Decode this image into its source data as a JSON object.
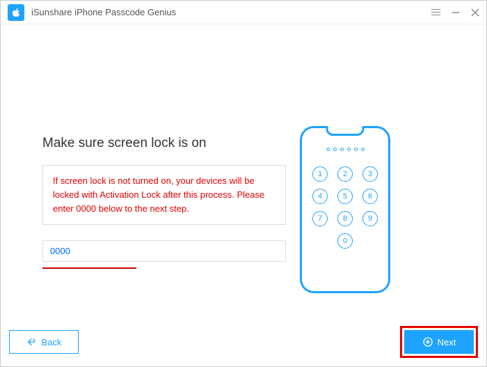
{
  "titlebar": {
    "title": "iSunshare iPhone Passcode Genius"
  },
  "main": {
    "heading": "Make sure screen lock is on",
    "warning": "If screen lock is not turned on, your devices will be locked with Activation Lock after this process. Please enter 0000 below to the next step.",
    "input_value": "0000"
  },
  "keypad": {
    "keys": [
      "1",
      "2",
      "3",
      "4",
      "5",
      "6",
      "7",
      "8",
      "9",
      "0"
    ]
  },
  "footer": {
    "back_label": "Back",
    "next_label": "Next"
  }
}
